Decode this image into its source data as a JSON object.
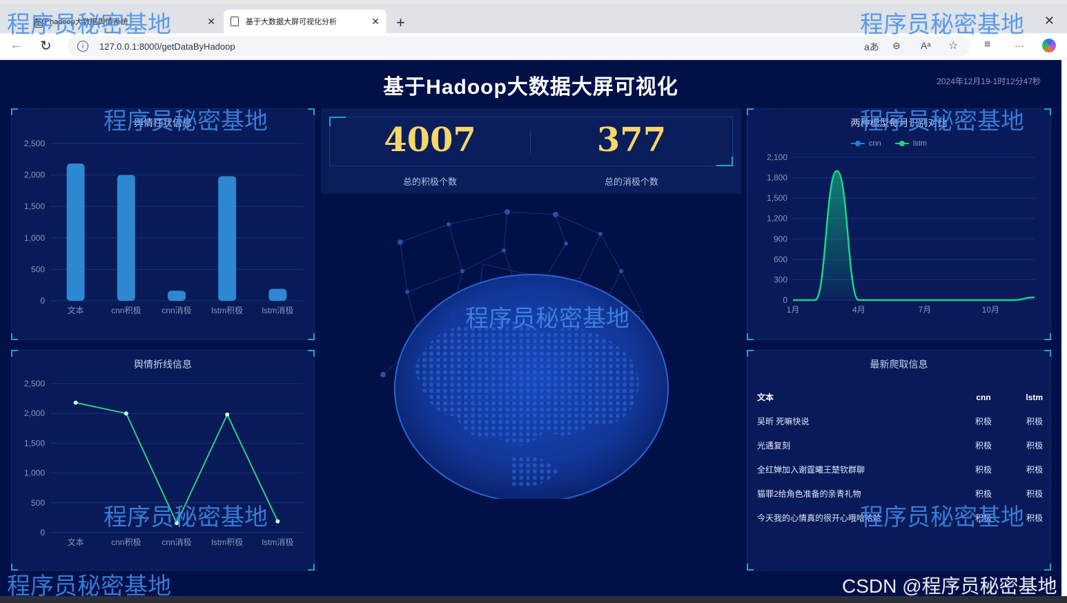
{
  "browser": {
    "tabs": [
      {
        "label": "基于hadoop大数据舆情系统",
        "active": false
      },
      {
        "label": "基于大数据大屏可视化分析",
        "active": true
      }
    ],
    "url": "127.0.0.1:8000/getDataByHadoop"
  },
  "dashboard": {
    "title": "基于Hadoop大数据大屏可视化",
    "timestamp": "2024年12月19-1时12分47秒",
    "kpis": [
      {
        "value": "4007",
        "label": "总的积极个数"
      },
      {
        "value": "377",
        "label": "总的消极个数"
      }
    ],
    "table": {
      "title": "最新爬取信息",
      "headers": [
        "文本",
        "cnn",
        "lstm"
      ],
      "rows": [
        [
          "吴昕 死嘛快说",
          "积极",
          "积极"
        ],
        [
          "光遇复刻",
          "积极",
          "积极"
        ],
        [
          "全红婵加入谢霆曦王楚钦群聊",
          "积极",
          "积极"
        ],
        [
          "猫罪2给角色准备的亲青礼物",
          "积极",
          "积极"
        ],
        [
          "今天我的心情真的很开心哦哈哈哈",
          "积极",
          "积极"
        ]
      ]
    }
  },
  "chart_data": [
    {
      "type": "bar",
      "title": "舆情柱状信息",
      "categories": [
        "文本",
        "cnn积极",
        "cnn消极",
        "lstm积极",
        "lstm消极"
      ],
      "values": [
        2180,
        2000,
        160,
        1980,
        190
      ],
      "ylim": [
        0,
        2500
      ],
      "yticks": [
        0,
        500,
        1000,
        1500,
        2000,
        2500
      ],
      "color": "#2e87d1"
    },
    {
      "type": "line",
      "title": "舆情折线信息",
      "categories": [
        "文本",
        "cnn积极",
        "cnn消极",
        "lstm积极",
        "lstm消极"
      ],
      "values": [
        2180,
        2000,
        160,
        1980,
        190
      ],
      "ylim": [
        0,
        2500
      ],
      "yticks": [
        0,
        500,
        1000,
        1500,
        2000,
        2500
      ],
      "color": "#2ecc8e"
    },
    {
      "type": "area",
      "title": "两种模型每月识别对比",
      "x": [
        "1月",
        "2月",
        "3月",
        "4月",
        "5月",
        "6月",
        "7月",
        "8月",
        "9月",
        "10月",
        "11月",
        "12月"
      ],
      "xticks": [
        "1月",
        "4月",
        "7月",
        "10月"
      ],
      "series": [
        {
          "name": "cnn",
          "values": [
            0,
            0,
            1900,
            0,
            0,
            0,
            0,
            0,
            0,
            0,
            0,
            40
          ],
          "color": "#1f7ee0"
        },
        {
          "name": "lstm",
          "values": [
            0,
            0,
            1900,
            0,
            0,
            0,
            0,
            0,
            0,
            0,
            0,
            40
          ],
          "color": "#19d48a"
        }
      ],
      "ylim": [
        0,
        2100
      ],
      "yticks": [
        0,
        300,
        600,
        900,
        1200,
        1500,
        1800,
        2100
      ],
      "legend": "top"
    }
  ],
  "watermarks": {
    "text": "程序员秘密基地",
    "csdn": "CSDN @程序员秘密基地"
  }
}
